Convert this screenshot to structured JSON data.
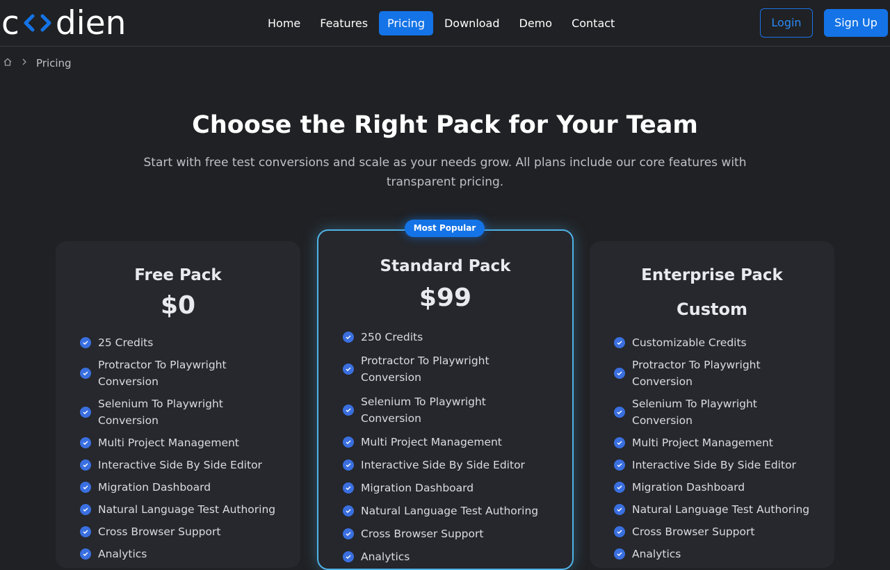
{
  "brand": {
    "logo_prefix": "c",
    "logo_suffix": "dien",
    "accent_color": "#1473e6"
  },
  "nav": {
    "items": [
      {
        "label": "Home",
        "active": false
      },
      {
        "label": "Features",
        "active": false
      },
      {
        "label": "Pricing",
        "active": true
      },
      {
        "label": "Download",
        "active": false
      },
      {
        "label": "Demo",
        "active": false
      },
      {
        "label": "Contact",
        "active": false
      }
    ],
    "login_label": "Login",
    "signup_label": "Sign Up"
  },
  "breadcrumb": {
    "home_icon": "home-icon",
    "current": "Pricing"
  },
  "hero": {
    "title": "Choose the Right Pack for Your Team",
    "subtitle": "Start with free test conversions and scale as your needs grow. All plans include our core features with transparent pricing."
  },
  "plans": [
    {
      "name": "Free Pack",
      "price": "$0",
      "features": [
        "25 Credits",
        "Protractor To Playwright Conversion",
        "Selenium To Playwright Conversion",
        "Multi Project Management",
        "Interactive Side By Side Editor",
        "Migration Dashboard",
        "Natural Language Test Authoring",
        "Cross Browser Support",
        "Analytics"
      ]
    },
    {
      "name": "Standard Pack",
      "price": "$99",
      "badge": "Most Popular",
      "features": [
        "250 Credits",
        "Protractor To Playwright Conversion",
        "Selenium To Playwright Conversion",
        "Multi Project Management",
        "Interactive Side By Side Editor",
        "Migration Dashboard",
        "Natural Language Test Authoring",
        "Cross Browser Support",
        "Analytics"
      ]
    },
    {
      "name": "Enterprise Pack",
      "price": "Custom",
      "features": [
        "Customizable Credits",
        "Protractor To Playwright Conversion",
        "Selenium To Playwright Conversion",
        "Multi Project Management",
        "Interactive Side By Side Editor",
        "Migration Dashboard",
        "Natural Language Test Authoring",
        "Cross Browser Support",
        "Analytics"
      ]
    }
  ]
}
